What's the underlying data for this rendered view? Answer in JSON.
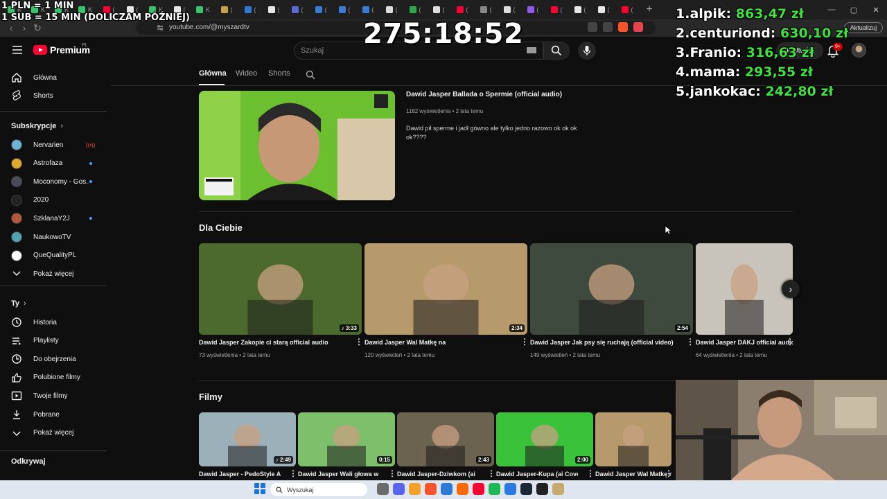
{
  "browser": {
    "url": "youtube.com/@myszardtv",
    "update_label": "Aktualizuj",
    "new_tab": "+",
    "tabs": [
      {
        "glyph": "K",
        "color": "#36c36a"
      },
      {
        "glyph": "K",
        "color": "#36c36a"
      },
      {
        "glyph": "K",
        "color": "#36c36a"
      },
      {
        "glyph": "K",
        "color": "#36c36a"
      },
      {
        "glyph": "(",
        "color": "#ff0033"
      },
      {
        "glyph": "(",
        "color": "#e8e8e8"
      },
      {
        "glyph": "K",
        "color": "#36c36a"
      },
      {
        "glyph": "(",
        "color": "#e8e8e8"
      },
      {
        "glyph": "K",
        "color": "#36c36a"
      },
      {
        "glyph": "(",
        "color": "#c4a24a"
      },
      {
        "glyph": "(",
        "color": "#2d7ad6"
      },
      {
        "glyph": "(",
        "color": "#e8e8e8"
      },
      {
        "glyph": "(",
        "color": "#5b6bd6"
      },
      {
        "glyph": "(",
        "color": "#3a7bd5"
      },
      {
        "glyph": "(",
        "color": "#3a7bd5"
      },
      {
        "glyph": "(",
        "color": "#3a7bd5"
      },
      {
        "glyph": "(",
        "color": "#dddddd"
      },
      {
        "glyph": "(",
        "color": "#2aa84a"
      },
      {
        "glyph": "(",
        "color": "#dddddd"
      },
      {
        "glyph": "(",
        "color": "#ff0033"
      },
      {
        "glyph": "(",
        "color": "#888888"
      },
      {
        "glyph": "(",
        "color": "#dddddd"
      },
      {
        "glyph": "(",
        "color": "#8f5be8"
      },
      {
        "glyph": "(",
        "color": "#ff0033"
      },
      {
        "glyph": "(",
        "color": "#e8e8e8"
      },
      {
        "glyph": "(",
        "color": "#e8e8e8"
      },
      {
        "glyph": "(",
        "color": "#ff0033"
      }
    ]
  },
  "header": {
    "logo_text": "Premium",
    "region": "PL",
    "search_placeholder": "Szukaj",
    "create_label": "Utwórz",
    "notifications_badge": "9+"
  },
  "sidebar": {
    "home": "Główna",
    "shorts": "Shorts",
    "subscriptions_title": "Subskrypcje",
    "subscriptions": [
      {
        "name": "Nervarien",
        "color": "#6fb2d8",
        "indicator": "live"
      },
      {
        "name": "Astrofaza",
        "color": "#e0a92c",
        "indicator": "dot"
      },
      {
        "name": "Moconomy - Gos...",
        "color": "#4a4a5a",
        "indicator": "dot"
      },
      {
        "name": "2020",
        "color": "#222222",
        "indicator": "none"
      },
      {
        "name": "SzklanaY2J",
        "color": "#b4573a",
        "indicator": "dot"
      },
      {
        "name": "NaukowoTV",
        "color": "#4fa3b3",
        "indicator": "none"
      },
      {
        "name": "QueQualityPL",
        "color": "#ffffff",
        "indicator": "none"
      }
    ],
    "show_more": "Pokaż więcej",
    "you_title": "Ty",
    "you_items": [
      "Historia",
      "Playlisty",
      "Do obejrzenia",
      "Polubione filmy",
      "Twoje filmy",
      "Pobrane",
      "Pokaż więcej"
    ],
    "explore_title": "Odkrywaj"
  },
  "channel_tabs": [
    "Główna",
    "Wideo",
    "Shorts"
  ],
  "featured": {
    "title": "Dawid Jasper Ballada o Spermie (official audio)",
    "views": "1182 wyświetlenia",
    "age": "2 lata temu",
    "description": "Dawid pił sperme i jadł gówno ale tylko jedno razowo ok ok ok ok????"
  },
  "dla_ciebie": {
    "title": "Dla Ciebie",
    "videos": [
      {
        "title": "Dawid Jasper Zakopie ci starą official audio",
        "views": "73 wyświetlenia",
        "age": "2 lata temu",
        "duration": "3:33",
        "music": true,
        "bg": "#4c6a2e"
      },
      {
        "title": "Dawid Jasper Wal Matkę na",
        "views": "120 wyświetleń",
        "age": "2 lata temu",
        "duration": "2:34",
        "music": false,
        "bg": "#b79a6b"
      },
      {
        "title": "Dawid Jasper Jak psy się ruchają (official video)",
        "views": "149 wyświetleń",
        "age": "2 lata temu",
        "duration": "2:54",
        "music": false,
        "bg": "#3f4a3f"
      },
      {
        "title": "Dawid Jasper DAKJ official audio",
        "views": "64 wyświetlenia",
        "age": "2 lata temu",
        "duration": "",
        "music": false,
        "bg": "#c9c4bb"
      }
    ]
  },
  "filmy": {
    "title": "Filmy",
    "videos": [
      {
        "title": "Dawid Jasper - PedoStyle A",
        "duration": "2:49",
        "music": true,
        "bg": "#9bb0b8"
      },
      {
        "title": "Dawid Jasper Wali głowa w",
        "duration": "0:15",
        "music": false,
        "bg": "#7dbf6a"
      },
      {
        "title": "Dawid Jasper-Dziwkom (ai",
        "duration": "2:43",
        "music": false,
        "bg": "#6c6250"
      },
      {
        "title": "Dawid Jasper-Kupa (ai Cover)",
        "duration": "2:00",
        "music": false,
        "bg": "#39c23a"
      },
      {
        "title": "Dawid Jasper Wal Matkę na",
        "duration": "",
        "music": false,
        "bg": "#b79a6b"
      }
    ]
  },
  "overlay": {
    "rule_1": "1 PLN = 1 MIN",
    "rule_2": "1 SUB = 15 MIN (DOLICZAM PÓŹNIEJ)",
    "timer": "275:18:52",
    "donors": [
      {
        "rank": "1.",
        "name": "alpik:",
        "amount": "863,47 zł"
      },
      {
        "rank": "2.",
        "name": "centuriond:",
        "amount": "630,10 zł"
      },
      {
        "rank": "3.",
        "name": "Franio:",
        "amount": "316,63 zł"
      },
      {
        "rank": "4.",
        "name": "mama:",
        "amount": "293,55 zł"
      },
      {
        "rank": "5.",
        "name": "jankokac:",
        "amount": "242,80 zł"
      }
    ]
  },
  "taskbar": {
    "search_placeholder": "Wyszukaj",
    "icons": [
      "#6b6b6b",
      "#5865f2",
      "#f4a12a",
      "#fb542b",
      "#2d7ad6",
      "#ff6a00",
      "#ff0033",
      "#1db954",
      "#2a7ae2",
      "#1b2838",
      "#222222",
      "#c8aa6e"
    ]
  }
}
